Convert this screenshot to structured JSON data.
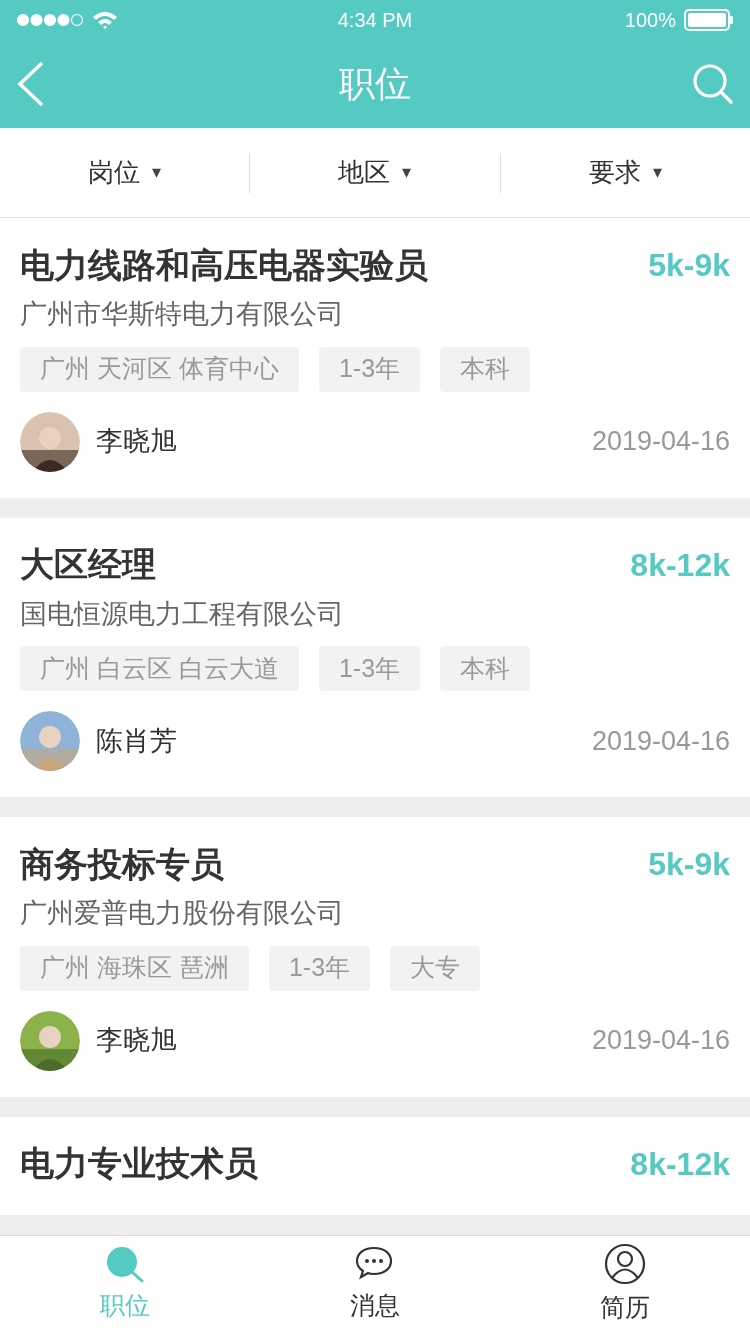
{
  "status_bar": {
    "time": "4:34 PM",
    "battery": "100%"
  },
  "nav": {
    "title": "职位"
  },
  "filters": [
    {
      "label": "岗位",
      "caret": "▾"
    },
    {
      "label": "地区",
      "caret": "▾"
    },
    {
      "label": "要求",
      "caret": "▾"
    }
  ],
  "jobs": [
    {
      "title": "电力线路和高压电器实验员",
      "salary": "5k-9k",
      "company": "广州市华斯特电力有限公司",
      "tags": [
        "广州 天河区 体育中心",
        "1-3年",
        "本科"
      ],
      "person": "李晓旭",
      "date": "2019-04-16",
      "avatar": {
        "kind": "picture"
      }
    },
    {
      "title": "大区经理",
      "salary": "8k-12k",
      "company": "国电恒源电力工程有限公司",
      "tags": [
        "广州 白云区 白云大道",
        "1-3年",
        "本科"
      ],
      "person": "陈肖芳",
      "date": "2019-04-16",
      "avatar": {
        "kind": "picture"
      }
    },
    {
      "title": "商务投标专员",
      "salary": "5k-9k",
      "company": "广州爱普电力股份有限公司",
      "tags": [
        "广州 海珠区 琶洲",
        "1-3年",
        "大专"
      ],
      "person": "李晓旭",
      "date": "2019-04-16",
      "avatar": {
        "kind": "picture"
      }
    },
    {
      "title": "电力专业技术员",
      "salary": "8k-12k"
    }
  ],
  "tabbar": [
    {
      "label": "职位",
      "selected": true
    },
    {
      "label": "消息",
      "selected": false
    },
    {
      "label": "简历",
      "selected": false
    }
  ]
}
